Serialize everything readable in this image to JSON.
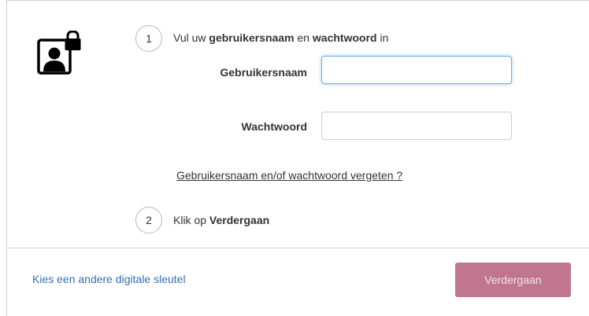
{
  "icon": {
    "name": "user-lock-icon"
  },
  "step1": {
    "number": "1",
    "prefix": "Vul uw ",
    "bold1": "gebruikersnaam",
    "middle": " en ",
    "bold2": "wachtwoord",
    "suffix": " in"
  },
  "form": {
    "username_label": "Gebruikersnaam",
    "username_value": "",
    "password_label": "Wachtwoord",
    "password_value": "",
    "forgot_link": "Gebruikersnaam en/of wachtwoord vergeten ?"
  },
  "step2": {
    "number": "2",
    "prefix": "Klik op ",
    "bold": "Verdergaan"
  },
  "footer": {
    "other_key_link": "Kies een andere digitale sleutel",
    "continue_label": "Verdergaan"
  },
  "colors": {
    "accent_button": "#c0768f",
    "link": "#3170b6",
    "focus_border": "#66afe9"
  }
}
